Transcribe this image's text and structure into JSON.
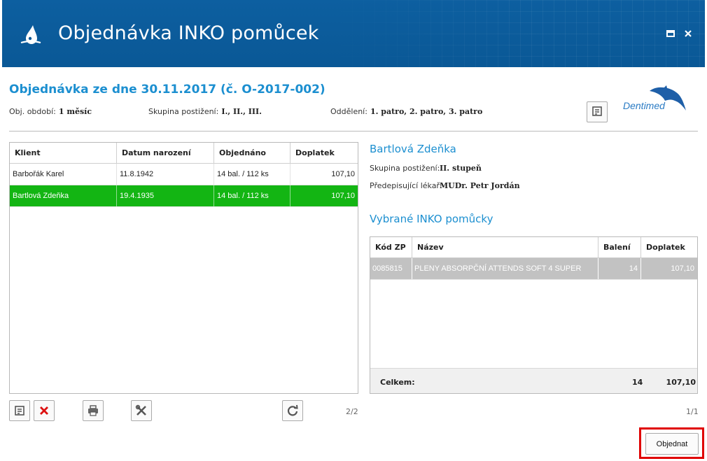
{
  "window": {
    "title": "Objednávka INKO pomůcek"
  },
  "header": {
    "order_title": "Objednávka ze dne 30.11.2017 (č. O-2017-002)",
    "period_label": "Obj. období:",
    "period_value": "1 měsíc",
    "group_label": "Skupina postižení:",
    "group_value": "I., II., III.",
    "dept_label": "Oddělení:",
    "dept_value": "1. patro, 2. patro, 3. patro",
    "logo_text": "Dentimed"
  },
  "clients_table": {
    "columns": [
      "Klient",
      "Datum narození",
      "Objednáno",
      "Doplatek"
    ],
    "rows": [
      {
        "name": "Barbořák Karel",
        "birth": "11.8.1942",
        "ordered": "14 bal. / 112 ks",
        "copay": "107,10"
      },
      {
        "name": "Bartlová Zdeňka",
        "birth": "19.4.1935",
        "ordered": "14 bal. / 112 ks",
        "copay": "107,10"
      }
    ],
    "selected_index": 1,
    "pager": "2/2"
  },
  "patient": {
    "name": "Bartlová Zdeňka",
    "group_label": "Skupina postižení:",
    "group_value": "II. stupeň",
    "doctor_label": "Předepisující lékař:",
    "doctor_value": "MUDr. Petr Jordán"
  },
  "items": {
    "title": "Vybrané INKO pomůcky",
    "columns": [
      "Kód ZP",
      "Název",
      "Balení",
      "Doplatek"
    ],
    "rows": [
      {
        "code": "0085815",
        "name": "PLENY ABSORPČNÍ ATTENDS SOFT 4 SUPER",
        "packs": "14",
        "copay": "107,10"
      }
    ],
    "total_label": "Celkem:",
    "total_packs": "14",
    "total_copay": "107,10",
    "pager": "1/1"
  },
  "actions": {
    "order_label": "Objednat"
  },
  "colors": {
    "titlebar": "#0a5896",
    "accent": "#1c8fd0",
    "selected_row": "#13b513",
    "highlight": "#e00000"
  }
}
